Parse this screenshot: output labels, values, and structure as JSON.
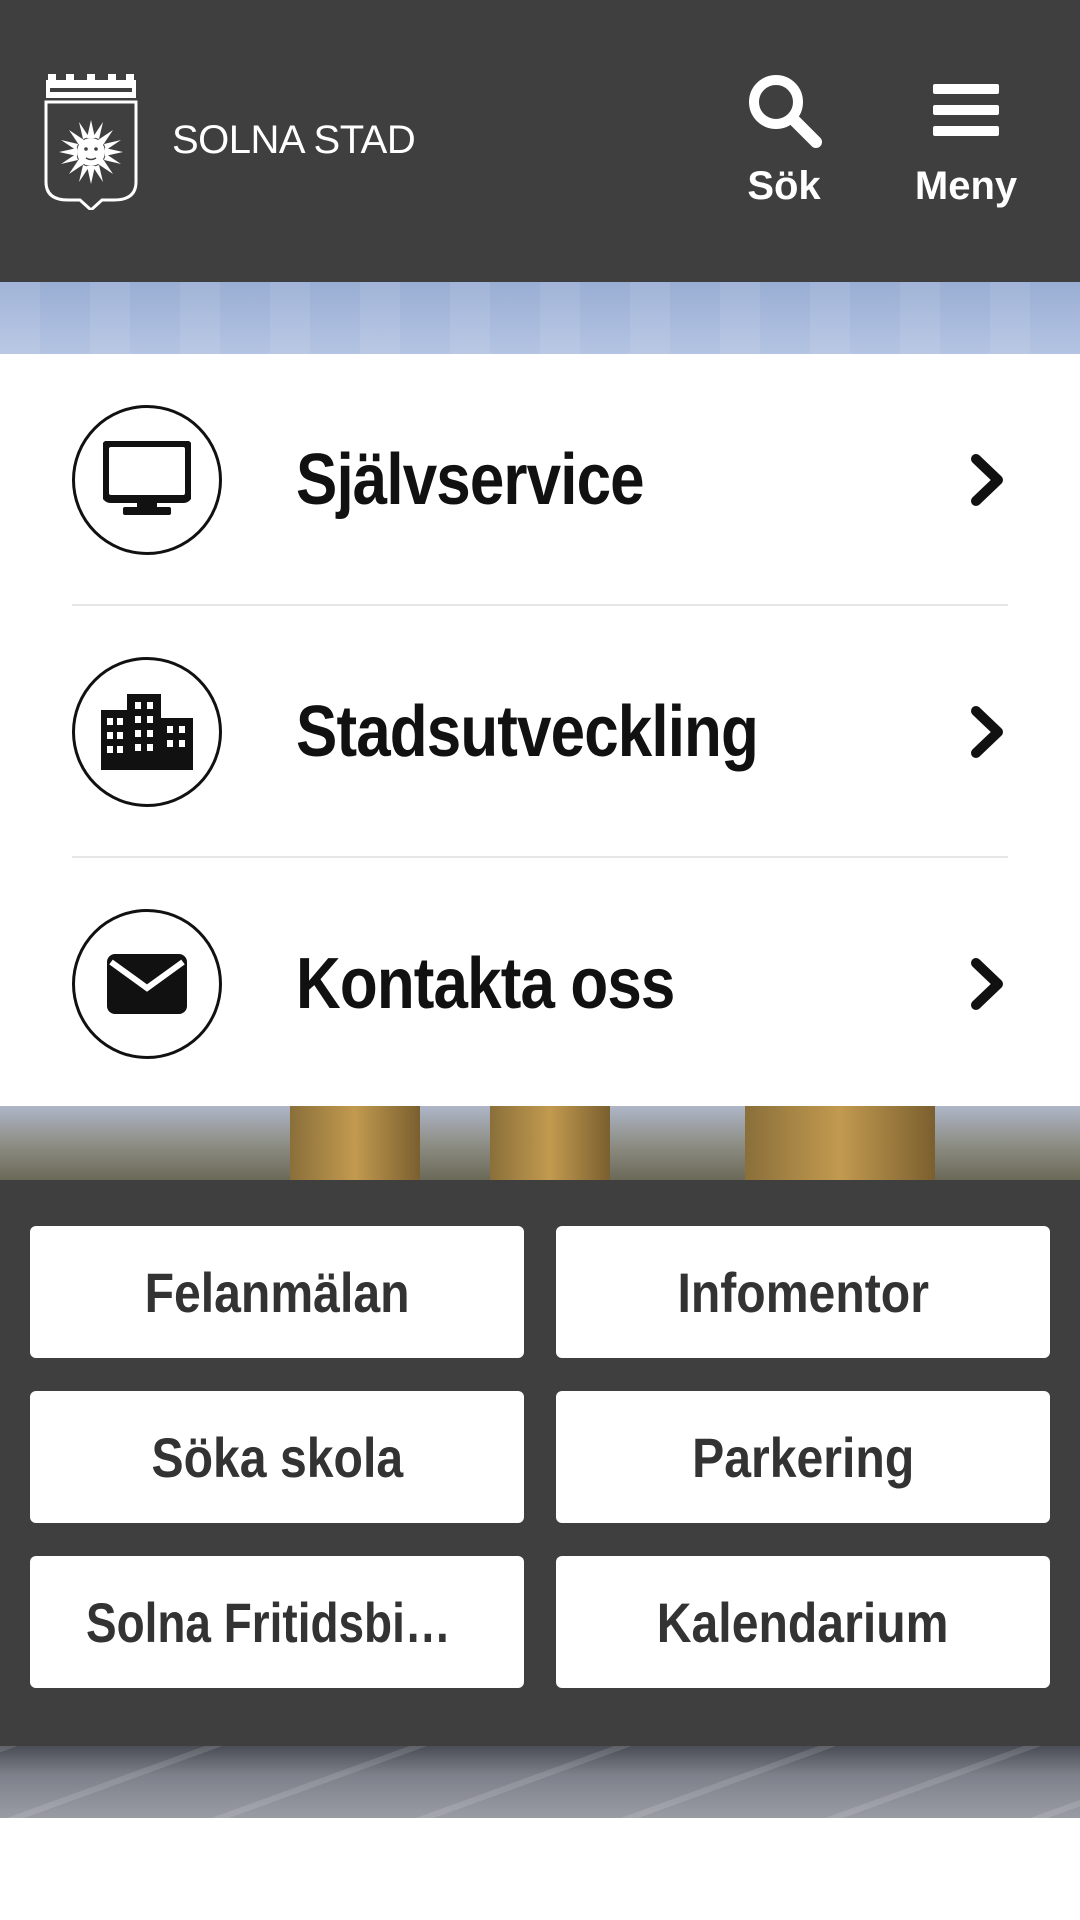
{
  "header": {
    "brand": "SOLNA STAD",
    "search_label": "Sök",
    "menu_label": "Meny"
  },
  "quicklinks": [
    {
      "label": "Självservice",
      "icon": "monitor-icon"
    },
    {
      "label": "Stadsutveckling",
      "icon": "buildings-icon"
    },
    {
      "label": "Kontakta oss",
      "icon": "envelope-icon"
    }
  ],
  "services": [
    {
      "label": "Felanmälan"
    },
    {
      "label": "Infomentor"
    },
    {
      "label": "Söka skola"
    },
    {
      "label": "Parkering"
    },
    {
      "label": "Solna Fritidsbibliotek"
    },
    {
      "label": "Kalendarium"
    }
  ],
  "colors": {
    "header_bg": "#3f3f3f",
    "button_bg": "#ffffff",
    "button_text": "#333333"
  }
}
